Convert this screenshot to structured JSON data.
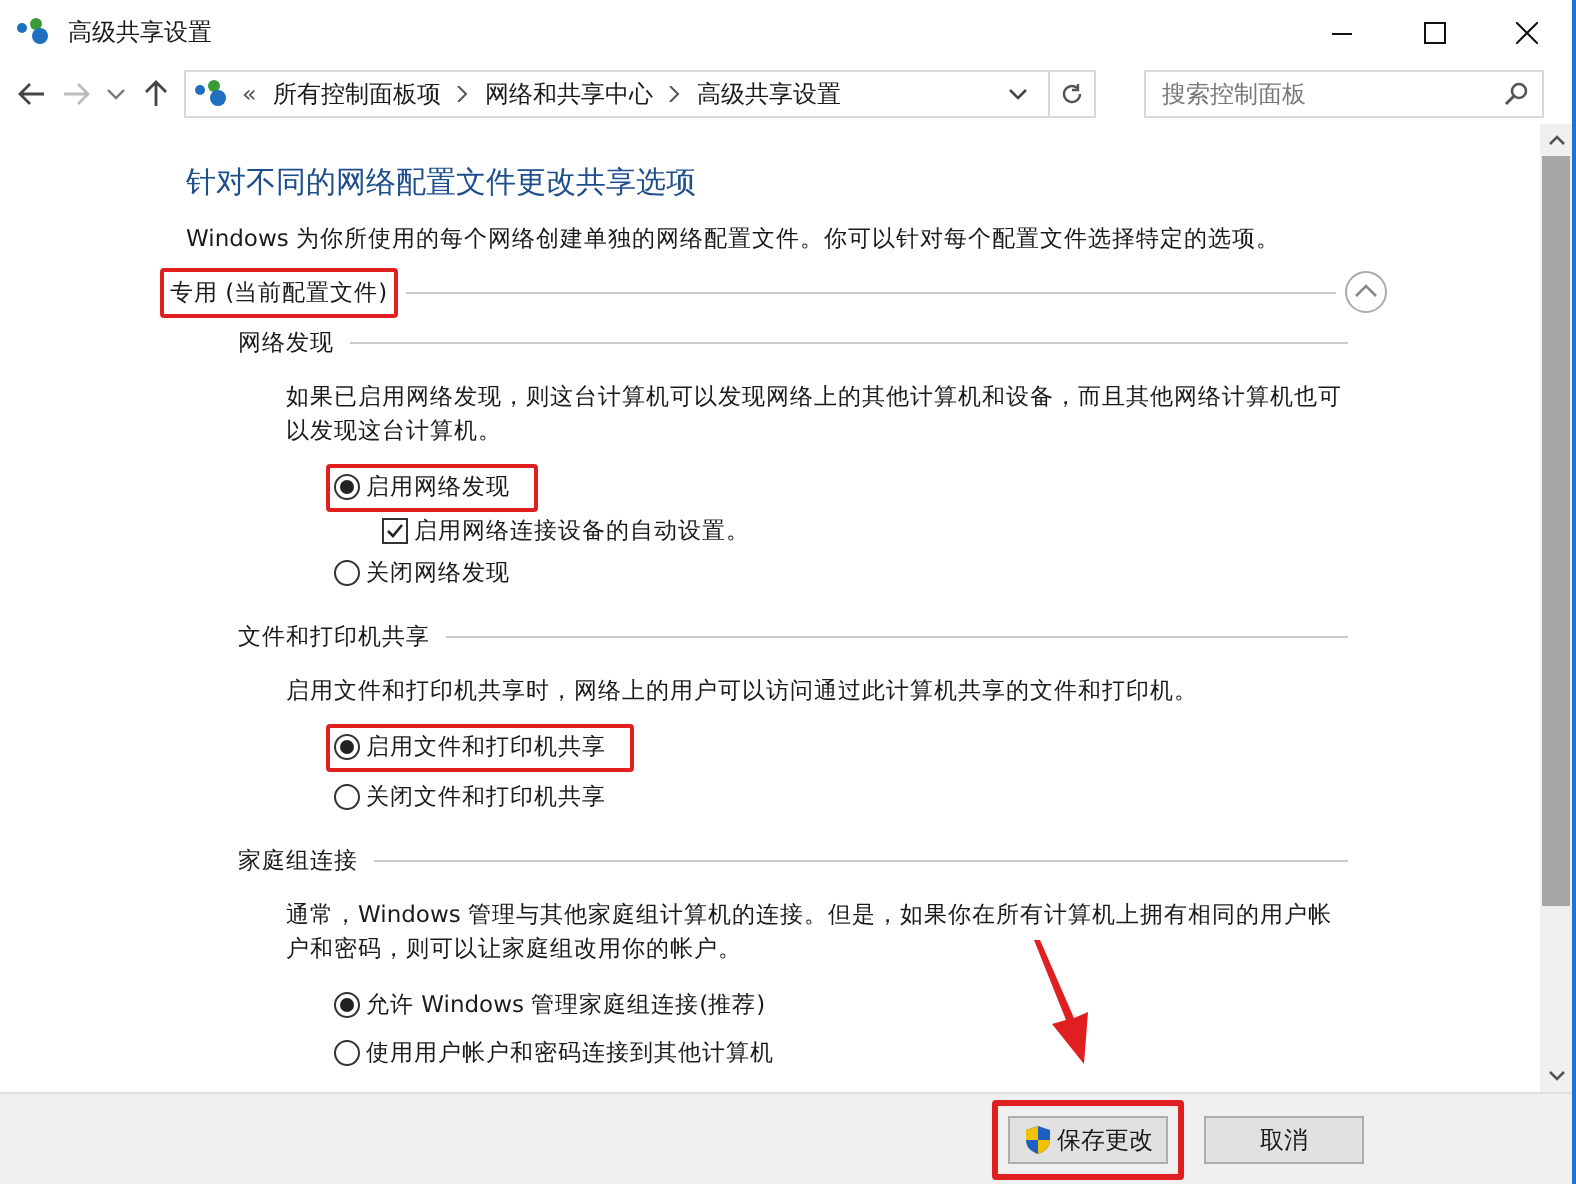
{
  "window": {
    "title": "高级共享设置"
  },
  "address_bar": {
    "overflow": "«",
    "crumbs": [
      "所有控制面板项",
      "网络和共享中心",
      "高级共享设置"
    ]
  },
  "search": {
    "placeholder": "搜索控制面板"
  },
  "heading": "针对不同的网络配置文件更改共享选项",
  "intro": "Windows 为你所使用的每个网络创建单独的网络配置文件。你可以针对每个配置文件选择特定的选项。",
  "profile": {
    "title": "专用 (当前配置文件)",
    "expanded": true
  },
  "sections": [
    {
      "title": "网络发现",
      "description": "如果已启用网络发现，则这台计算机可以发现网络上的其他计算机和设备，而且其他网络计算机也可以发现这台计算机。",
      "options": [
        {
          "kind": "radio",
          "label": "启用网络发现",
          "selected": true,
          "annotated": true
        },
        {
          "kind": "checkbox",
          "label": "启用网络连接设备的自动设置。",
          "checked": true
        },
        {
          "kind": "radio",
          "label": "关闭网络发现",
          "selected": false
        }
      ]
    },
    {
      "title": "文件和打印机共享",
      "description": "启用文件和打印机共享时，网络上的用户可以访问通过此计算机共享的文件和打印机。",
      "options": [
        {
          "kind": "radio",
          "label": "启用文件和打印机共享",
          "selected": true,
          "annotated": true
        },
        {
          "kind": "radio",
          "label": "关闭文件和打印机共享",
          "selected": false
        }
      ]
    },
    {
      "title": "家庭组连接",
      "description": "通常，Windows 管理与其他家庭组计算机的连接。但是，如果你在所有计算机上拥有相同的用户帐户和密码，则可以让家庭组改用你的帐户。",
      "options": [
        {
          "kind": "radio",
          "label": "允许 Windows 管理家庭组连接(推荐)",
          "selected": true
        },
        {
          "kind": "radio",
          "label": "使用用户帐户和密码连接到其他计算机",
          "selected": false
        }
      ]
    }
  ],
  "buttons": [
    {
      "kind": "shield",
      "label": "保存更改"
    },
    {
      "kind": "plain",
      "label": "取消"
    }
  ]
}
